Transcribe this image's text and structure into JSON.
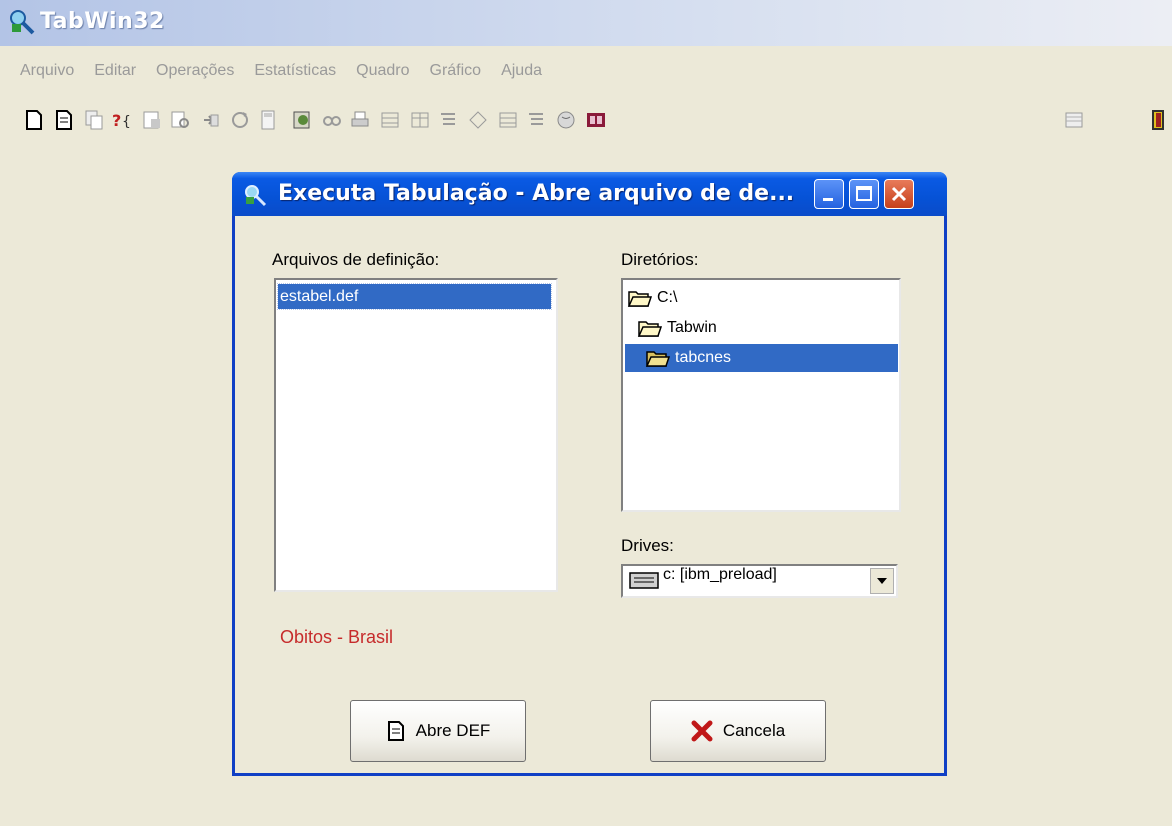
{
  "app": {
    "title": "TabWin32",
    "menu": [
      "Arquivo",
      "Editar",
      "Operações",
      "Estatísticas",
      "Quadro",
      "Gráfico",
      "Ajuda"
    ]
  },
  "toolbar": {
    "icons": [
      "new-document-icon",
      "open-document-icon",
      "copy-document-icon",
      "help-icon",
      "document-tools-icon",
      "search-document-icon",
      "import-icon",
      "refresh-icon",
      "calculator-icon",
      "paint-document-icon",
      "preview-icon",
      "print-icon",
      "table-icon",
      "table-grid-icon",
      "list-icon",
      "chart-icon",
      "table-alt-icon",
      "list-alt-icon",
      "globe-icon",
      "book-icon",
      "grid-icon",
      "exit-door-icon"
    ]
  },
  "dialog": {
    "title": "Executa Tabulação - Abre arquivo de de...",
    "files_label": "Arquivos de definição:",
    "files": [
      "estabel.def"
    ],
    "dirs_label": "Diretórios:",
    "directories": [
      "C:\\",
      "Tabwin",
      "tabcnes"
    ],
    "drives_label": "Drives:",
    "drive_value": "c: [ibm_preload]",
    "info_text": "Obitos - Brasil",
    "open_button": "Abre DEF",
    "cancel_button": "Cancela"
  },
  "colors": {
    "selection": "#316ac5",
    "title_bar": "#0652d6",
    "info_text": "#c62b2b",
    "window_bg": "#ece9d8"
  }
}
